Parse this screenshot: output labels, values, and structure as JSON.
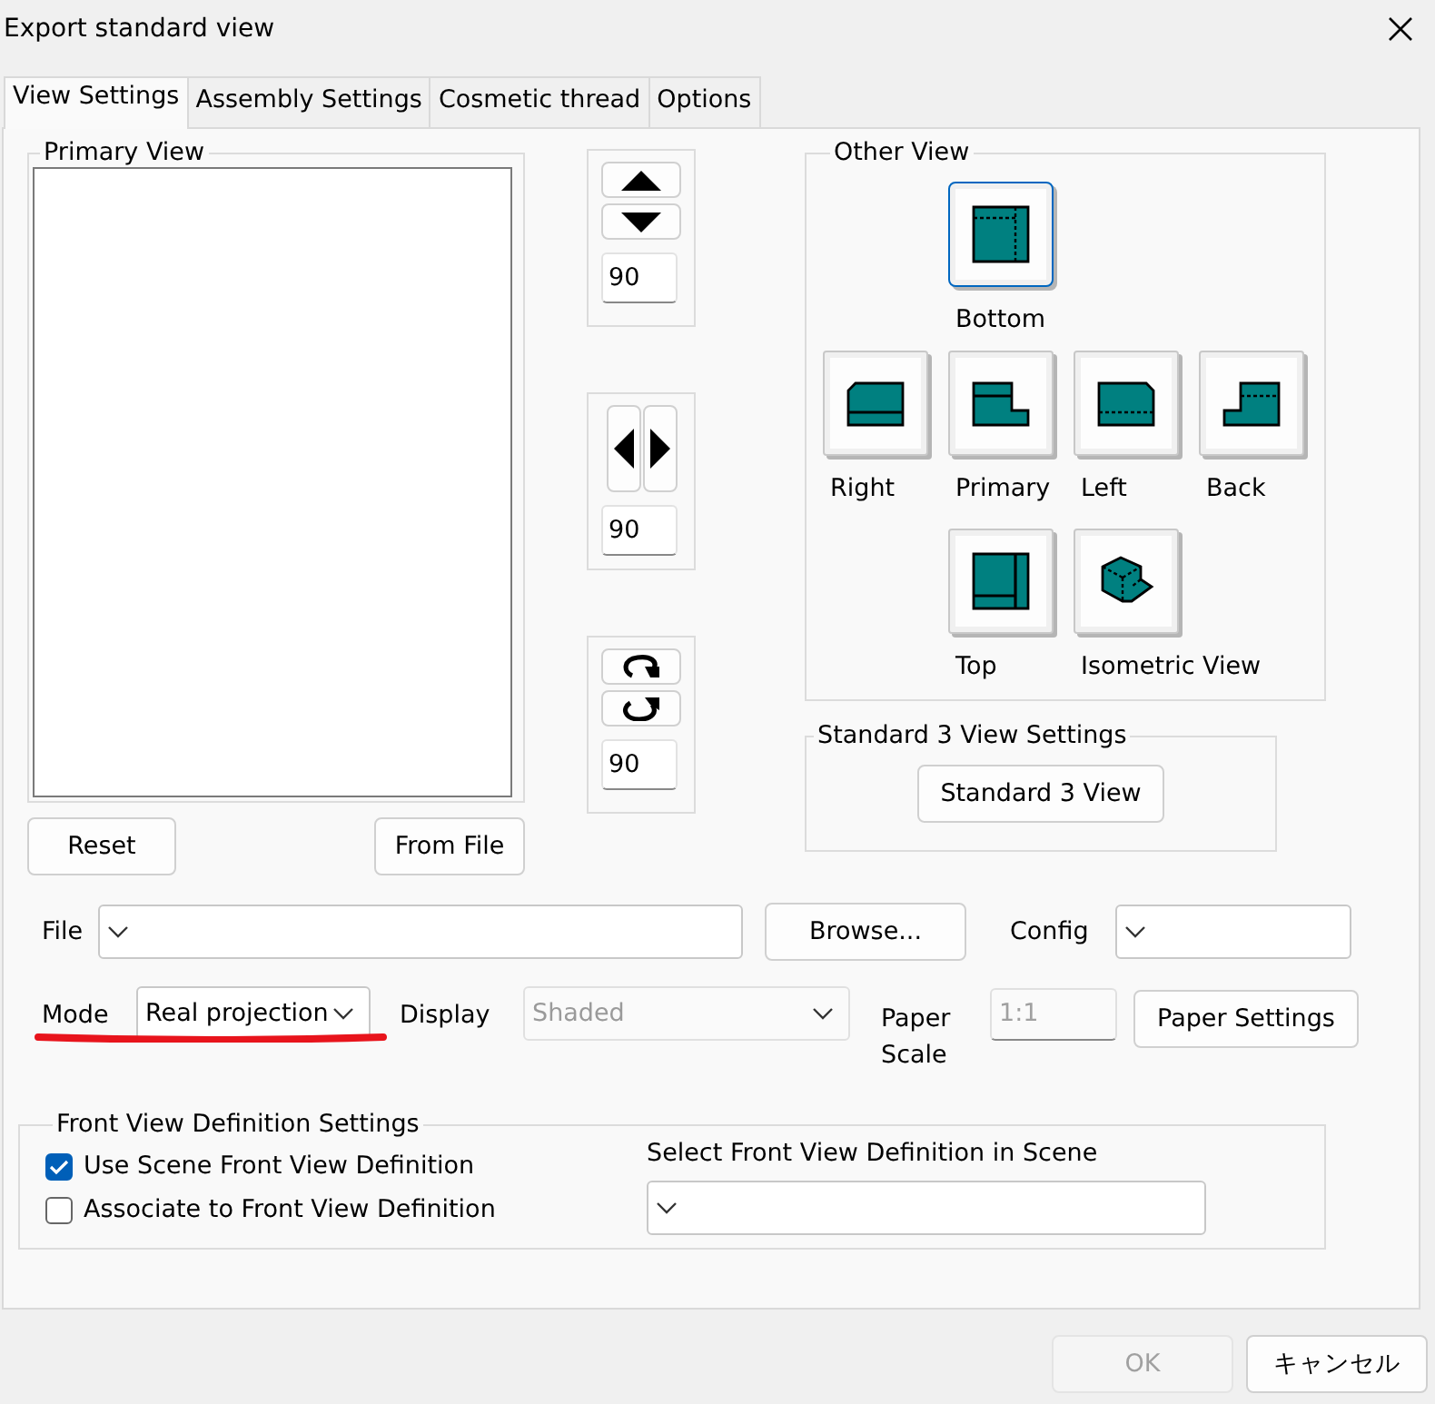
{
  "window": {
    "title": "Export standard view"
  },
  "tabs": [
    {
      "label": "View Settings",
      "selected": true
    },
    {
      "label": "Assembly Settings",
      "selected": false
    },
    {
      "label": "Cosmetic thread",
      "selected": false
    },
    {
      "label": "Options",
      "selected": false
    }
  ],
  "primary_view": {
    "title": "Primary View",
    "reset_button": "Reset",
    "from_file_button": "From File"
  },
  "rotation_controls": [
    {
      "kind": "vertical",
      "value": "90"
    },
    {
      "kind": "horizontal",
      "value": "90"
    },
    {
      "kind": "rotate",
      "value": "90"
    }
  ],
  "other_view": {
    "title": "Other View",
    "rows": [
      {
        "views": [
          {
            "kind": "bottom",
            "label": "Bottom",
            "focused": true
          }
        ]
      },
      {
        "views": [
          {
            "kind": "right",
            "label": "Right",
            "focused": false
          },
          {
            "kind": "primary",
            "label": "Primary",
            "focused": false
          },
          {
            "kind": "left",
            "label": "Left",
            "focused": false
          },
          {
            "kind": "back",
            "label": "Back",
            "focused": false
          }
        ]
      },
      {
        "views": [
          {
            "kind": "top",
            "label": "Top",
            "focused": false
          },
          {
            "kind": "isometric",
            "label": "Isometric View",
            "focused": false
          }
        ]
      }
    ]
  },
  "standard_3_view": {
    "title": "Standard 3 View Settings",
    "button": "Standard 3 View"
  },
  "file": {
    "label": "File",
    "browse_button": "Browse...",
    "config_label": "Config"
  },
  "mode": {
    "label": "Mode",
    "value": "Real projection"
  },
  "display": {
    "label": "Display",
    "value": "Shaded",
    "disabled": true
  },
  "paper_scale": {
    "label": "Paper Scale",
    "value": "1:1",
    "disabled": true
  },
  "paper_settings_button": "Paper Settings",
  "front_view": {
    "title": "Front View Definition Settings",
    "checkboxes": [
      {
        "label": "Use Scene Front View Definition",
        "checked": true
      },
      {
        "label": "Associate to Front View Definition",
        "checked": false
      }
    ],
    "select_label": "Select Front View Definition in Scene"
  },
  "footer_buttons": [
    {
      "label": "OK",
      "disabled": true
    },
    {
      "label": "キャンセル",
      "disabled": false
    }
  ]
}
